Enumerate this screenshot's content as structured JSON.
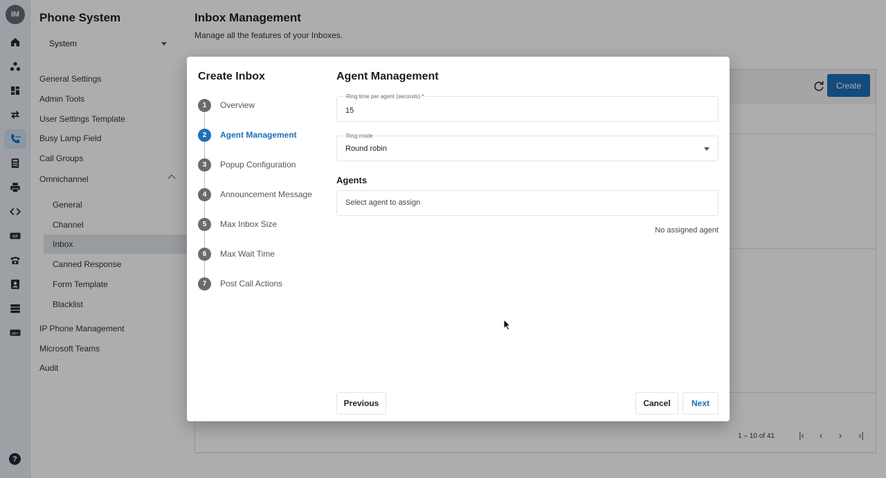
{
  "rail": {
    "avatar": "IM",
    "icons": [
      "home-icon",
      "network-icon",
      "dashboard-icon",
      "transfer-icon",
      "phone-settings-icon",
      "calculator-icon",
      "printer-icon",
      "code-icon",
      "sip-icon",
      "telephone-icon",
      "contacts-icon",
      "storage-icon",
      "sip-trunk-icon"
    ],
    "active_icon": "phone-settings-icon",
    "help": "?"
  },
  "sidebar": {
    "title": "Phone System",
    "select_value": "System",
    "items": [
      "General Settings",
      "Admin Tools",
      "User Settings Template",
      "Busy Lamp Field",
      "Call Groups",
      "Omnichannel"
    ],
    "omnichannel_subitems": [
      "General",
      "Channel",
      "Inbox",
      "Canned Response",
      "Form Template",
      "Blacklist"
    ],
    "active_subitem": "Inbox",
    "items_after": [
      "IP Phone Management",
      "Microsoft Teams",
      "Audit"
    ]
  },
  "page": {
    "title": "Inbox Management",
    "subtitle": "Manage all the features of your Inboxes.",
    "create_label": "Create",
    "pagination": "1 – 10 of 41"
  },
  "dialog": {
    "title": "Create Inbox",
    "steps": [
      {
        "num": "1",
        "label": "Overview"
      },
      {
        "num": "2",
        "label": "Agent Management"
      },
      {
        "num": "3",
        "label": "Popup Configuration"
      },
      {
        "num": "4",
        "label": "Announcement Message"
      },
      {
        "num": "5",
        "label": "Max Inbox Size"
      },
      {
        "num": "6",
        "label": "Max Wait Time"
      },
      {
        "num": "7",
        "label": "Post Call Actions"
      }
    ],
    "active_step": 2,
    "section_title": "Agent Management",
    "ring_time_label": "Ring time per agent (seconds) *",
    "ring_time_value": "15",
    "ring_mode_label": "Ring mode",
    "ring_mode_value": "Round robin",
    "agents_heading": "Agents",
    "agent_placeholder": "Select agent to assign",
    "no_agent_text": "No assigned agent",
    "previous_label": "Previous",
    "cancel_label": "Cancel",
    "next_label": "Next"
  }
}
